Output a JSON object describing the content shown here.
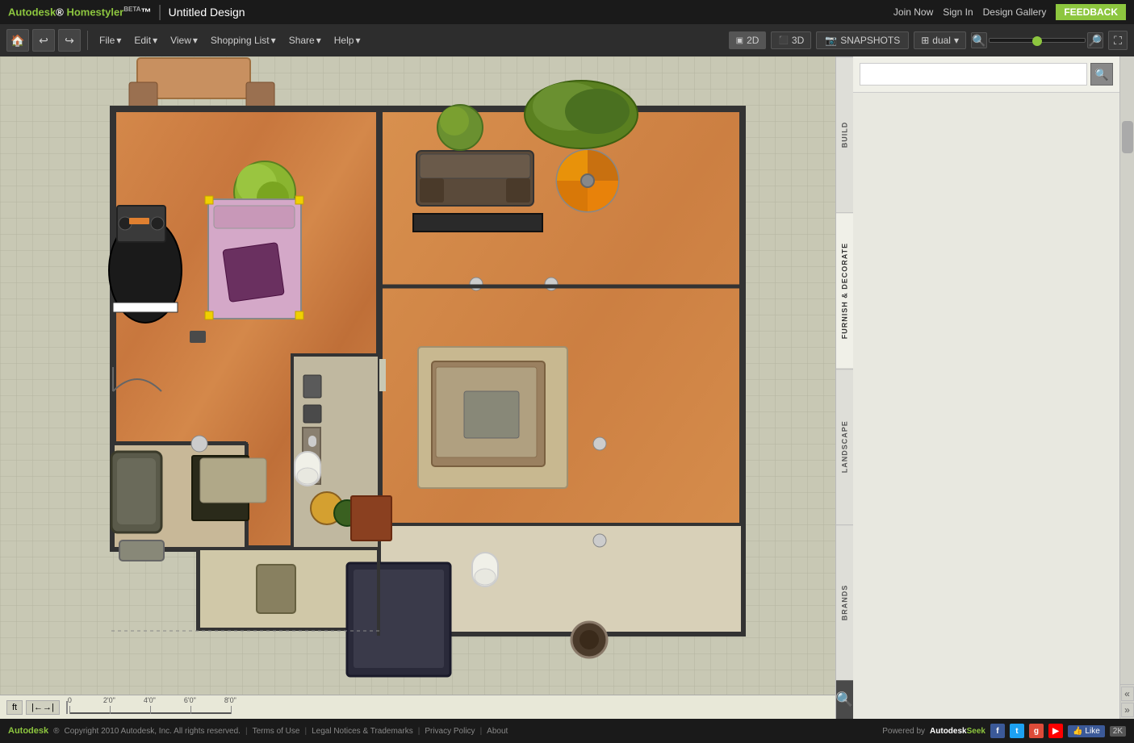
{
  "topbar": {
    "logo": "Autodesk",
    "logo_green": "Homestyler",
    "beta": "BETA",
    "divider": "|",
    "title": "Untitled Design",
    "join_now": "Join Now",
    "sign_in": "Sign In",
    "design_gallery": "Design Gallery",
    "feedback": "FEEDBACK"
  },
  "toolbar": {
    "menus": [
      "File",
      "Edit",
      "View",
      "Shopping List",
      "Share",
      "Help"
    ],
    "view_2d": "2D",
    "view_3d": "3D",
    "snapshots": "SNAPSHOTS",
    "dual": "dual"
  },
  "sidebar": {
    "tabs": [
      "BUILD",
      "FURNISH & DECORATE",
      "LANDSCAPE",
      "BRANDS"
    ],
    "search_placeholder": ""
  },
  "ruler": {
    "unit": "ft",
    "marks": [
      "2'0\"",
      "4'0\"",
      "6'0\"",
      "8'0\""
    ]
  },
  "footer": {
    "copyright": "Copyright 2010 Autodesk, Inc. All rights reserved.",
    "terms": "Terms of Use",
    "legal": "Legal Notices & Trademarks",
    "privacy": "Privacy Policy",
    "about": "About",
    "powered_by": "Powered by",
    "autodesk": "Autodesk",
    "seek": "Seek",
    "like": "Like",
    "like_count": "2K"
  }
}
